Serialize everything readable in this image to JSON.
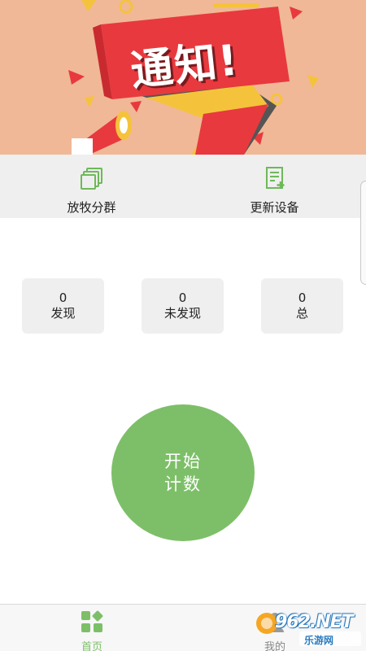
{
  "banner": {
    "text": "通知!",
    "colors": {
      "background": "#f0b896",
      "ribbon": "#e8393f",
      "accent": "#f5c33b",
      "dark": "#555555"
    }
  },
  "actions": [
    {
      "label": "放牧分群",
      "icon": "copy-stack-icon"
    },
    {
      "label": "更新设备",
      "icon": "document-add-icon"
    }
  ],
  "stats": {
    "found": {
      "value": "0",
      "label": "发现"
    },
    "not_found": {
      "value": "0",
      "label": "未发现"
    },
    "total": {
      "value": "0",
      "label": "总"
    }
  },
  "start_button": {
    "line1": "开始",
    "line2": "计数",
    "color": "#7dbf68"
  },
  "bottom_nav": {
    "home": {
      "label": "首页",
      "icon": "grid-diamond-icon",
      "active": true
    },
    "mine": {
      "label": "我的",
      "icon": "person-icon",
      "active": false
    }
  },
  "watermark": {
    "text": "962.NET",
    "sub": "乐游网"
  },
  "colors": {
    "accent": "#7dbf68",
    "panel": "#efefef"
  }
}
